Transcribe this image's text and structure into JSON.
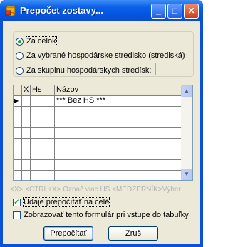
{
  "window": {
    "title": "Prepočet zostavy...",
    "minimize": "_",
    "maximize": "□",
    "close": "✕"
  },
  "scope": {
    "options": [
      {
        "label": "Za celok",
        "selected": true
      },
      {
        "label": "Za vybrané hospodárske stredisko (strediská)",
        "selected": false
      },
      {
        "label": "Za skupinu hospodárskych stredísk:",
        "selected": false
      }
    ],
    "group_value": ""
  },
  "grid": {
    "columns": [
      "X",
      "Hs",
      "Názov"
    ],
    "rows": [
      {
        "marker": "▶",
        "x": "",
        "hs": "",
        "nazov": "*** Bez HS ***"
      }
    ]
  },
  "hint": "<X>,<CTRL+X> Označ viac HS <MEDZERNÍK>Výber",
  "checks": [
    {
      "label": "Údaje prepočítať na celé",
      "checked": true
    },
    {
      "label": "Zobrazovať tento formulár pri vstupe do tabuľky",
      "checked": false
    }
  ],
  "buttons": {
    "recalc": "Prepočítať",
    "cancel": "Zruš"
  },
  "colors": {
    "title_bar": "#0a5fe8",
    "face": "#ece9d8",
    "radio_dot": "#21a121",
    "hint": "#b4b4b4"
  }
}
